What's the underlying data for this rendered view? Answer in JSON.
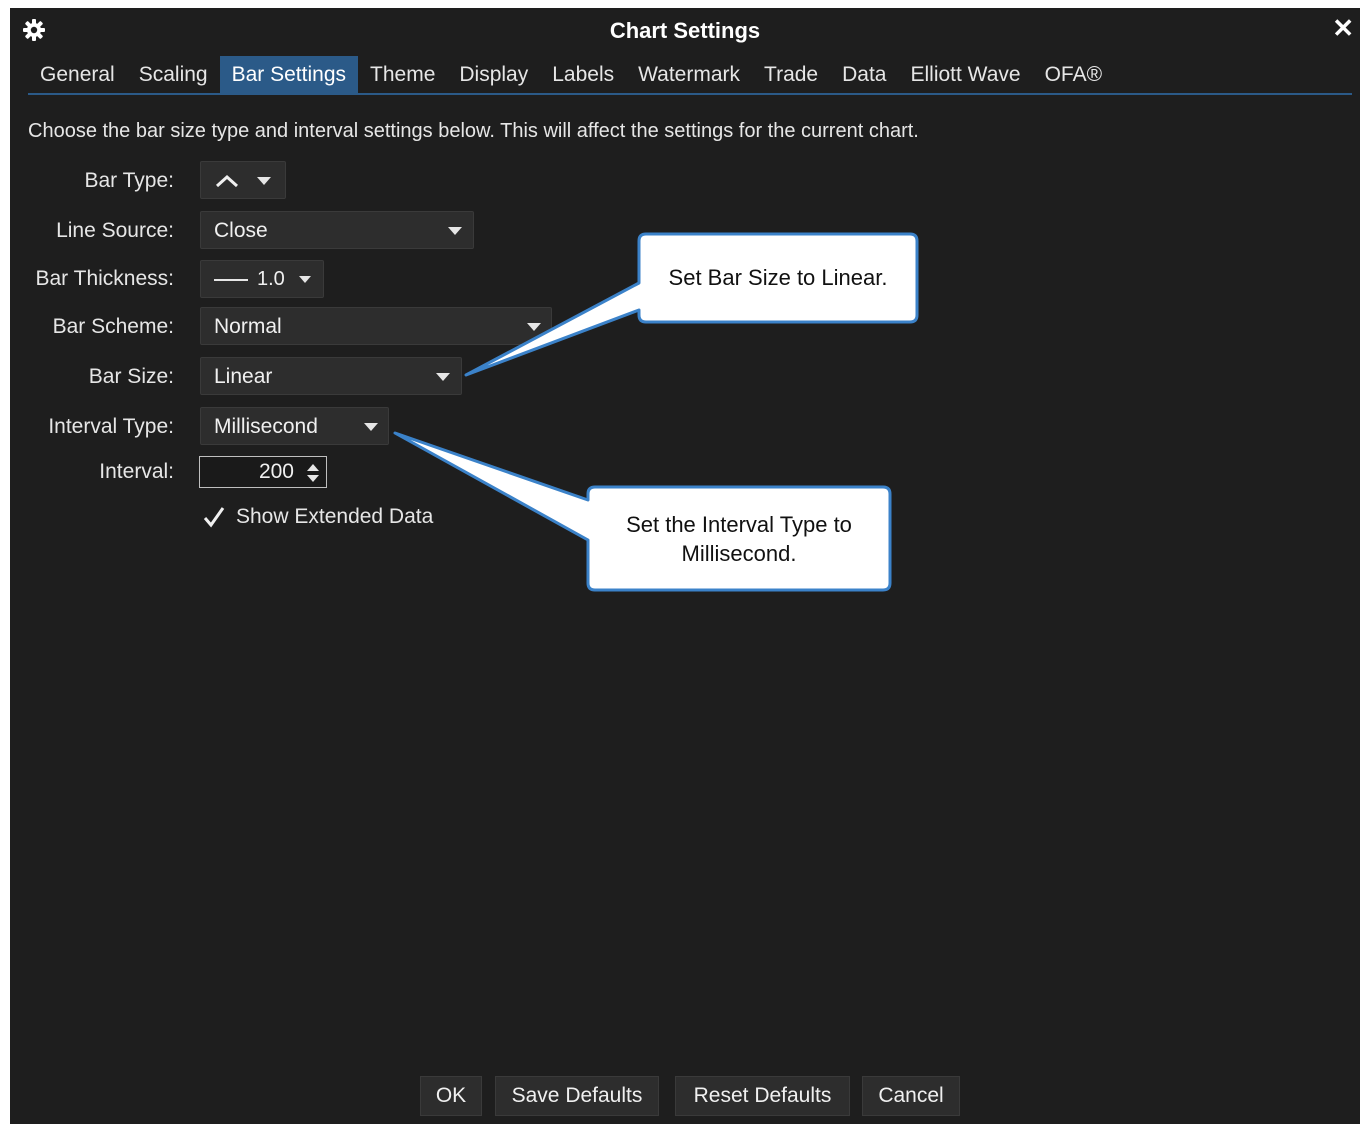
{
  "window": {
    "title": "Chart Settings",
    "close_glyph": "✕"
  },
  "tabs": [
    {
      "label": "General"
    },
    {
      "label": "Scaling"
    },
    {
      "label": "Bar Settings",
      "active": true
    },
    {
      "label": "Theme"
    },
    {
      "label": "Display"
    },
    {
      "label": "Labels"
    },
    {
      "label": "Watermark"
    },
    {
      "label": "Trade"
    },
    {
      "label": "Data"
    },
    {
      "label": "Elliott Wave"
    },
    {
      "label": "OFA®"
    }
  ],
  "description": "Choose the bar size type and interval settings below.  This will affect the settings for the current chart.",
  "form": {
    "bar_type": {
      "label": "Bar Type:",
      "icon": "line-chart-icon"
    },
    "line_source": {
      "label": "Line Source:",
      "value": "Close"
    },
    "bar_thickness": {
      "label": "Bar Thickness:",
      "value": "1.0"
    },
    "bar_scheme": {
      "label": "Bar Scheme:",
      "value": "Normal"
    },
    "bar_size": {
      "label": "Bar Size:",
      "value": "Linear"
    },
    "interval_type": {
      "label": "Interval Type:",
      "value": "Millisecond"
    },
    "interval": {
      "label": "Interval:",
      "value": "200"
    },
    "show_extended_data": {
      "label": "Show Extended Data",
      "checked": true
    }
  },
  "callouts": {
    "bar_size": "Set Bar Size to Linear.",
    "interval_type_line1": "Set the Interval Type to",
    "interval_type_line2": "Millisecond."
  },
  "buttons": {
    "ok": "OK",
    "save_defaults": "Save Defaults",
    "reset_defaults": "Reset Defaults",
    "cancel": "Cancel"
  },
  "colors": {
    "background": "#1e1e1e",
    "accent": "#2b5a88",
    "callout_border": "#3b82c9"
  }
}
